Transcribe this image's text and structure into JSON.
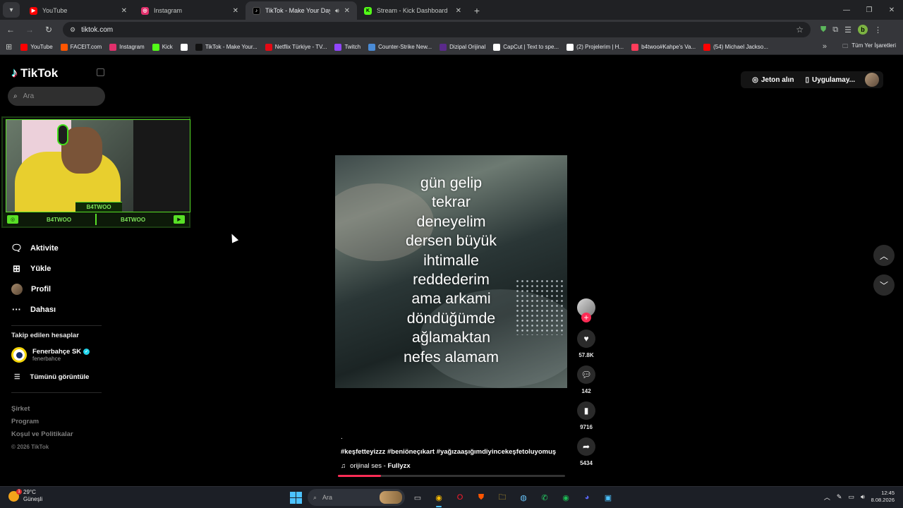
{
  "browser": {
    "tabs": [
      {
        "title": "YouTube",
        "icon": "youtube-icon",
        "color": "#ff0000",
        "active": false
      },
      {
        "title": "Instagram",
        "icon": "instagram-icon",
        "color": "#e1306c",
        "active": false
      },
      {
        "title": "TikTok - Make Your Day",
        "icon": "tiktok-icon",
        "color": "#000000",
        "active": true
      },
      {
        "title": "Stream - Kick Dashboard",
        "icon": "kick-icon",
        "color": "#53fc18",
        "active": false
      }
    ],
    "url": "tiktok.com",
    "profile_letter": "b",
    "bookmarks": [
      {
        "label": "YouTube",
        "color": "#ff0000"
      },
      {
        "label": "FACEIT.com",
        "color": "#ff5500"
      },
      {
        "label": "Instagram",
        "color": "#e1306c"
      },
      {
        "label": "Kick",
        "color": "#53fc18"
      },
      {
        "label": "",
        "color": "#ffffff"
      },
      {
        "label": "TikTok - Make Your...",
        "color": "#111111"
      },
      {
        "label": "Netflix Türkiye - TV...",
        "color": "#e50914"
      },
      {
        "label": "Twitch",
        "color": "#9146ff"
      },
      {
        "label": "Counter-Strike New...",
        "color": "#4a8bd6"
      },
      {
        "label": "Dizipal Orijinal",
        "color": "#5a2a8a"
      },
      {
        "label": "CapCut | Text to spe...",
        "color": "#ffffff"
      },
      {
        "label": "(2) Projelerim | H...",
        "color": "#ffffff"
      },
      {
        "label": "b4twoo#Kahpe's Va...",
        "color": "#ff3c5a"
      },
      {
        "label": "(54) Michael Jackso...",
        "color": "#ff0000"
      }
    ],
    "all_bookmarks_label": "Tüm Yer İşaretleri"
  },
  "tiktok": {
    "logo_text": "TikTok",
    "search_placeholder": "Ara",
    "webcam": {
      "tag": "B4TWOO",
      "bar_left": "B4TWOO",
      "bar_right": "B4TWOO"
    },
    "menu": [
      {
        "label": "Aktivite",
        "icon": "activity-icon"
      },
      {
        "label": "Yükle",
        "icon": "upload-icon"
      },
      {
        "label": "Profil",
        "icon": "profile-avatar"
      },
      {
        "label": "Dahası",
        "icon": "more-icon"
      }
    ],
    "following_header": "Takip edilen hesaplar",
    "following": [
      {
        "name": "Fenerbahçe SK",
        "handle": "fenerbahce",
        "verified": true
      }
    ],
    "see_all": "Tümünü görüntüle",
    "footer": [
      "Şirket",
      "Program",
      "Koşul ve Politikalar"
    ],
    "copyright": "© 2026 TikTok",
    "top_right": {
      "coins": "Jeton alın",
      "app": "Uygulamay..."
    },
    "video": {
      "caption_lines": [
        "gün gelip",
        "tekrar",
        "deneyelim",
        "dersen büyük",
        "ihtimalle",
        "reddederim",
        "ama arkami",
        "döndüğümde",
        "ağlamaktan",
        "nefes alamam"
      ],
      "dot": ".",
      "hashtags": "#keşfetteyizzz #beniöneçıkart #yağızaaşığımdiyincekeşfetoluyomuş",
      "sound_prefix": "orijinal ses - ",
      "sound_author": "Fullyzx",
      "progress": 0.19
    },
    "actions": [
      {
        "name": "like",
        "icon": "heart-icon",
        "count": "57.8K"
      },
      {
        "name": "comment",
        "icon": "comment-icon",
        "count": "142"
      },
      {
        "name": "save",
        "icon": "bookmark-icon",
        "count": "9716"
      },
      {
        "name": "share",
        "icon": "share-icon",
        "count": "5434"
      }
    ]
  },
  "taskbar": {
    "weather_temp": "29°C",
    "weather_desc": "Güneşli",
    "weather_badge": "1",
    "search_placeholder": "Ara",
    "time": "12:45",
    "date": "8.08.2026"
  }
}
